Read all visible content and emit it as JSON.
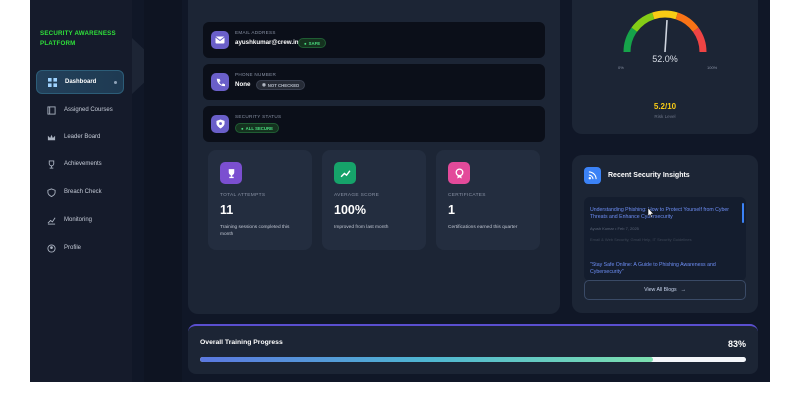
{
  "sidebar": {
    "brand": "SECURITY AWARENESS PLATFORM",
    "items": [
      {
        "label": "Dashboard",
        "icon": "grid-icon",
        "active": true
      },
      {
        "label": "Assigned Courses",
        "icon": "book-icon"
      },
      {
        "label": "Leader Board",
        "icon": "crown-icon"
      },
      {
        "label": "Achievements",
        "icon": "trophy-icon"
      },
      {
        "label": "Breach Check",
        "icon": "shield-icon"
      },
      {
        "label": "Monitoring",
        "icon": "chart-icon"
      },
      {
        "label": "Profile",
        "icon": "user-icon"
      }
    ]
  },
  "info": {
    "email": {
      "label": "EMAIL ADDRESS",
      "value": "ayushkumar@crew.in",
      "badge": "SAFE"
    },
    "phone": {
      "label": "PHONE NUMBER",
      "value": "None",
      "badge": "NOT CHECKED"
    },
    "security": {
      "label": "SECURITY STATUS",
      "badge": "ALL SECURE"
    }
  },
  "stats": [
    {
      "label": "TOTAL ATTEMPTS",
      "value": "11",
      "desc": "Training sessions completed this month",
      "icon": "trophy-icon",
      "color": "#7b4fd0"
    },
    {
      "label": "AVERAGE SCORE",
      "value": "100%",
      "desc": "Improved from last month",
      "icon": "trend-icon",
      "color": "#16a36a"
    },
    {
      "label": "CERTIFICATES",
      "value": "1",
      "desc": "Certifications earned this quarter",
      "icon": "badge-icon",
      "color": "#e34a9a"
    }
  ],
  "gauge": {
    "percent": "52.0%",
    "value": 0.52,
    "min": "0%",
    "max": "100%",
    "score": "5.2/10",
    "score_sub": "Risk Level"
  },
  "insights": {
    "title": "Recent Security Insights",
    "post1_title": "Understanding Phishing: How to Protect Yourself from Cyber Threats and Enhance Cybersecurity",
    "post1_meta": "Ayush Kumar  •  Feb 7, 2025",
    "post1_excerpt": "Email & Web Security, Gmail Help, IT Security Guidelines",
    "post2_title": "\"Stay Safe Online: A Guide to Phishing Awareness and Cybersecurity\"",
    "view_all": "View All Blogs"
  },
  "progress": {
    "title": "Overall Training Progress",
    "percent": "83%",
    "value": 0.83
  },
  "colors": {
    "accent": "#5a4fcf",
    "brand": "#2fe03a",
    "safe": "#4ade80",
    "score": "#facc15"
  }
}
